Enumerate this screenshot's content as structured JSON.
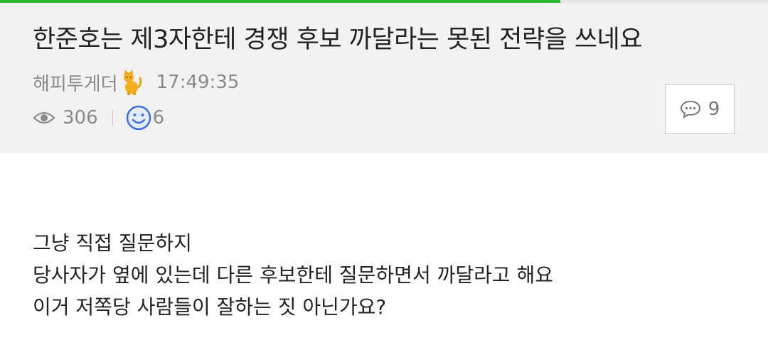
{
  "progress": {
    "fraction": 0.73,
    "color": "#2eb82e"
  },
  "post": {
    "title": "한준호는 제3자한테 경쟁 후보 까달라는 못된 전략을 쓰네요",
    "author": "해피투게더",
    "author_icon": "cat-icon",
    "time": "17:49:35",
    "views": "306",
    "likes": "6",
    "comments": "9"
  },
  "icons": {
    "views": "eye-icon",
    "likes": "smile-icon",
    "comments": "speech-bubble-icon"
  },
  "body": {
    "lines": [
      "그냥 직접 질문하지",
      "당사자가 옆에 있는데 다른 후보한테 질문하면서 까달라고 해요",
      "이거 저쪽당 사람들이 잘하는 짓 아닌가요?"
    ]
  }
}
